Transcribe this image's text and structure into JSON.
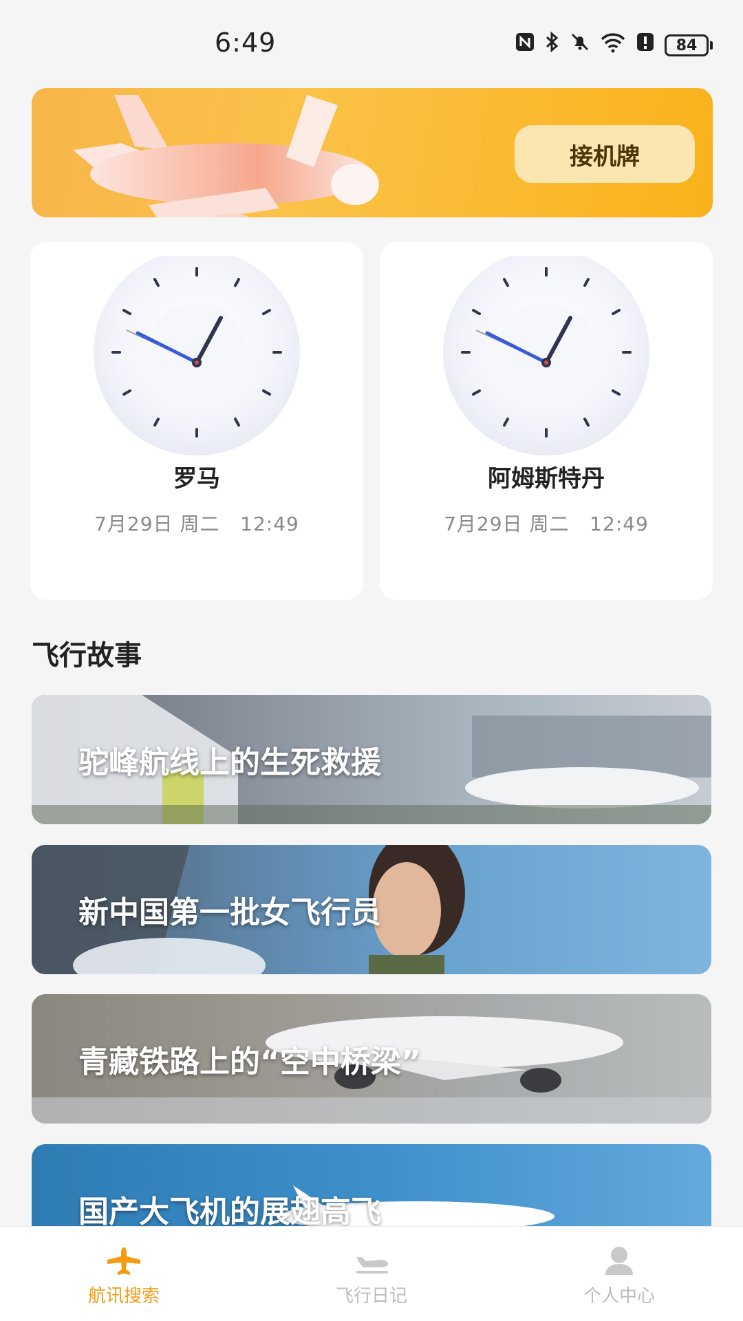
{
  "status_bar": {
    "time": "6:49",
    "battery": "84",
    "icons": [
      "nfc-icon",
      "bluetooth-icon",
      "mute-icon",
      "wifi-icon",
      "alert-icon",
      "battery-icon"
    ]
  },
  "banner": {
    "button_label": "接机牌",
    "colors": {
      "start": "#f7b54a",
      "end": "#f9b21a"
    }
  },
  "clocks": [
    {
      "city": "罗马",
      "date": "7月29日 周二",
      "time": "12:49"
    },
    {
      "city": "阿姆斯特丹",
      "date": "7月29日 周二",
      "time": "12:49"
    }
  ],
  "stories": {
    "section_title": "飞行故事",
    "items": [
      {
        "title": "驼峰航线上的生死救援"
      },
      {
        "title": "新中国第一批女飞行员"
      },
      {
        "title": "青藏铁路上的“空中桥梁”"
      },
      {
        "title": "国产大飞机的展翅高飞"
      }
    ]
  },
  "bottom_nav": {
    "items": [
      {
        "label": "航讯搜索",
        "icon": "plane-icon",
        "active": true
      },
      {
        "label": "飞行日记",
        "icon": "landing-icon",
        "active": false
      },
      {
        "label": "个人中心",
        "icon": "person-icon",
        "active": false
      }
    ],
    "active_color": "#f59b12",
    "inactive_color": "#bcbcbc"
  }
}
